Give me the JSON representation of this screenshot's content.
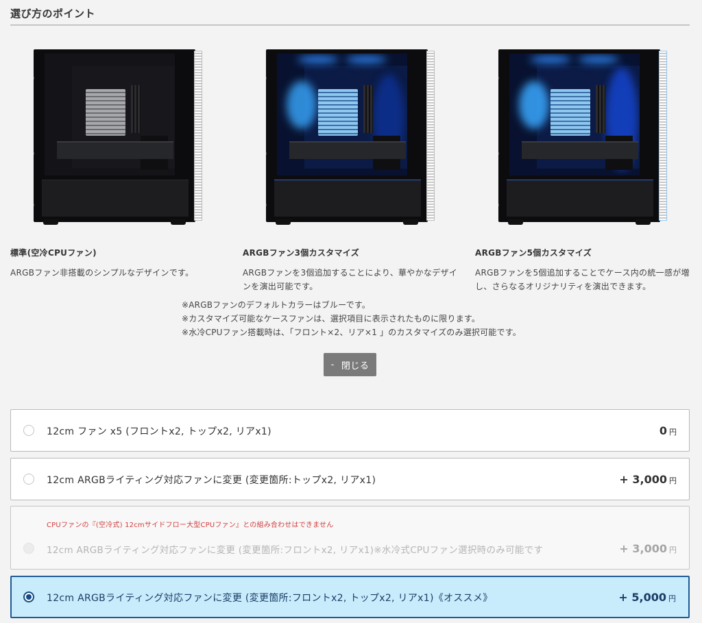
{
  "section": {
    "title": "選び方のポイント"
  },
  "columns": [
    {
      "title": "標準(空冷CPUファン)",
      "desc": "ARGBファン非搭載のシンプルなデザインです。",
      "image": "pc-case-standard"
    },
    {
      "title": "ARGBファン3個カスタマイズ",
      "desc": "ARGBファンを3個追加することにより、華やかなデザインを演出可能です。",
      "image": "pc-case-argb-3"
    },
    {
      "title": "ARGBファン5個カスタマイズ",
      "desc": "ARGBファンを5個追加することでケース内の統一感が増し、さらなるオリジナリティを演出できます。",
      "image": "pc-case-argb-5"
    }
  ],
  "notes": [
    "※ARGBファンのデフォルトカラーはブルーです。",
    "※カスタマイズ可能なケースファンは、選択項目に表示されたものに限ります。",
    "※水冷CPUファン搭載時は、「フロント×2、リア×1 」のカスタマイズのみ選択可能です。"
  ],
  "close_button": {
    "icon": "-",
    "label": "閉じる"
  },
  "options": [
    {
      "label": "12cm ファン x5 (フロントx2, トップx2, リアx1)",
      "price": "0",
      "unit": "円",
      "selected": false,
      "disabled": false
    },
    {
      "label": "12cm ARGBライティング対応ファンに変更 (変更箇所:トップx2, リアx1)",
      "price": "+ 3,000",
      "unit": "円",
      "selected": false,
      "disabled": false
    },
    {
      "warning": "CPUファンの『(空冷式) 12cmサイドフロー大型CPUファン』との組み合わせはできません",
      "label": "12cm ARGBライティング対応ファンに変更 (変更箇所:フロントx2, リアx1)※水冷式CPUファン選択時のみ可能です",
      "price": "+ 3,000",
      "unit": "円",
      "selected": false,
      "disabled": true
    },
    {
      "label": "12cm ARGBライティング対応ファンに変更 (変更箇所:フロントx2, トップx2, リアx1)《オススメ》",
      "price": "+ 5,000",
      "unit": "円",
      "selected": true,
      "disabled": false
    }
  ],
  "colors": {
    "selected_bg": "#c8ecfb",
    "selected_border": "#1e5a94",
    "warning": "#d23b3b",
    "button_bg": "#7a7a7a"
  }
}
